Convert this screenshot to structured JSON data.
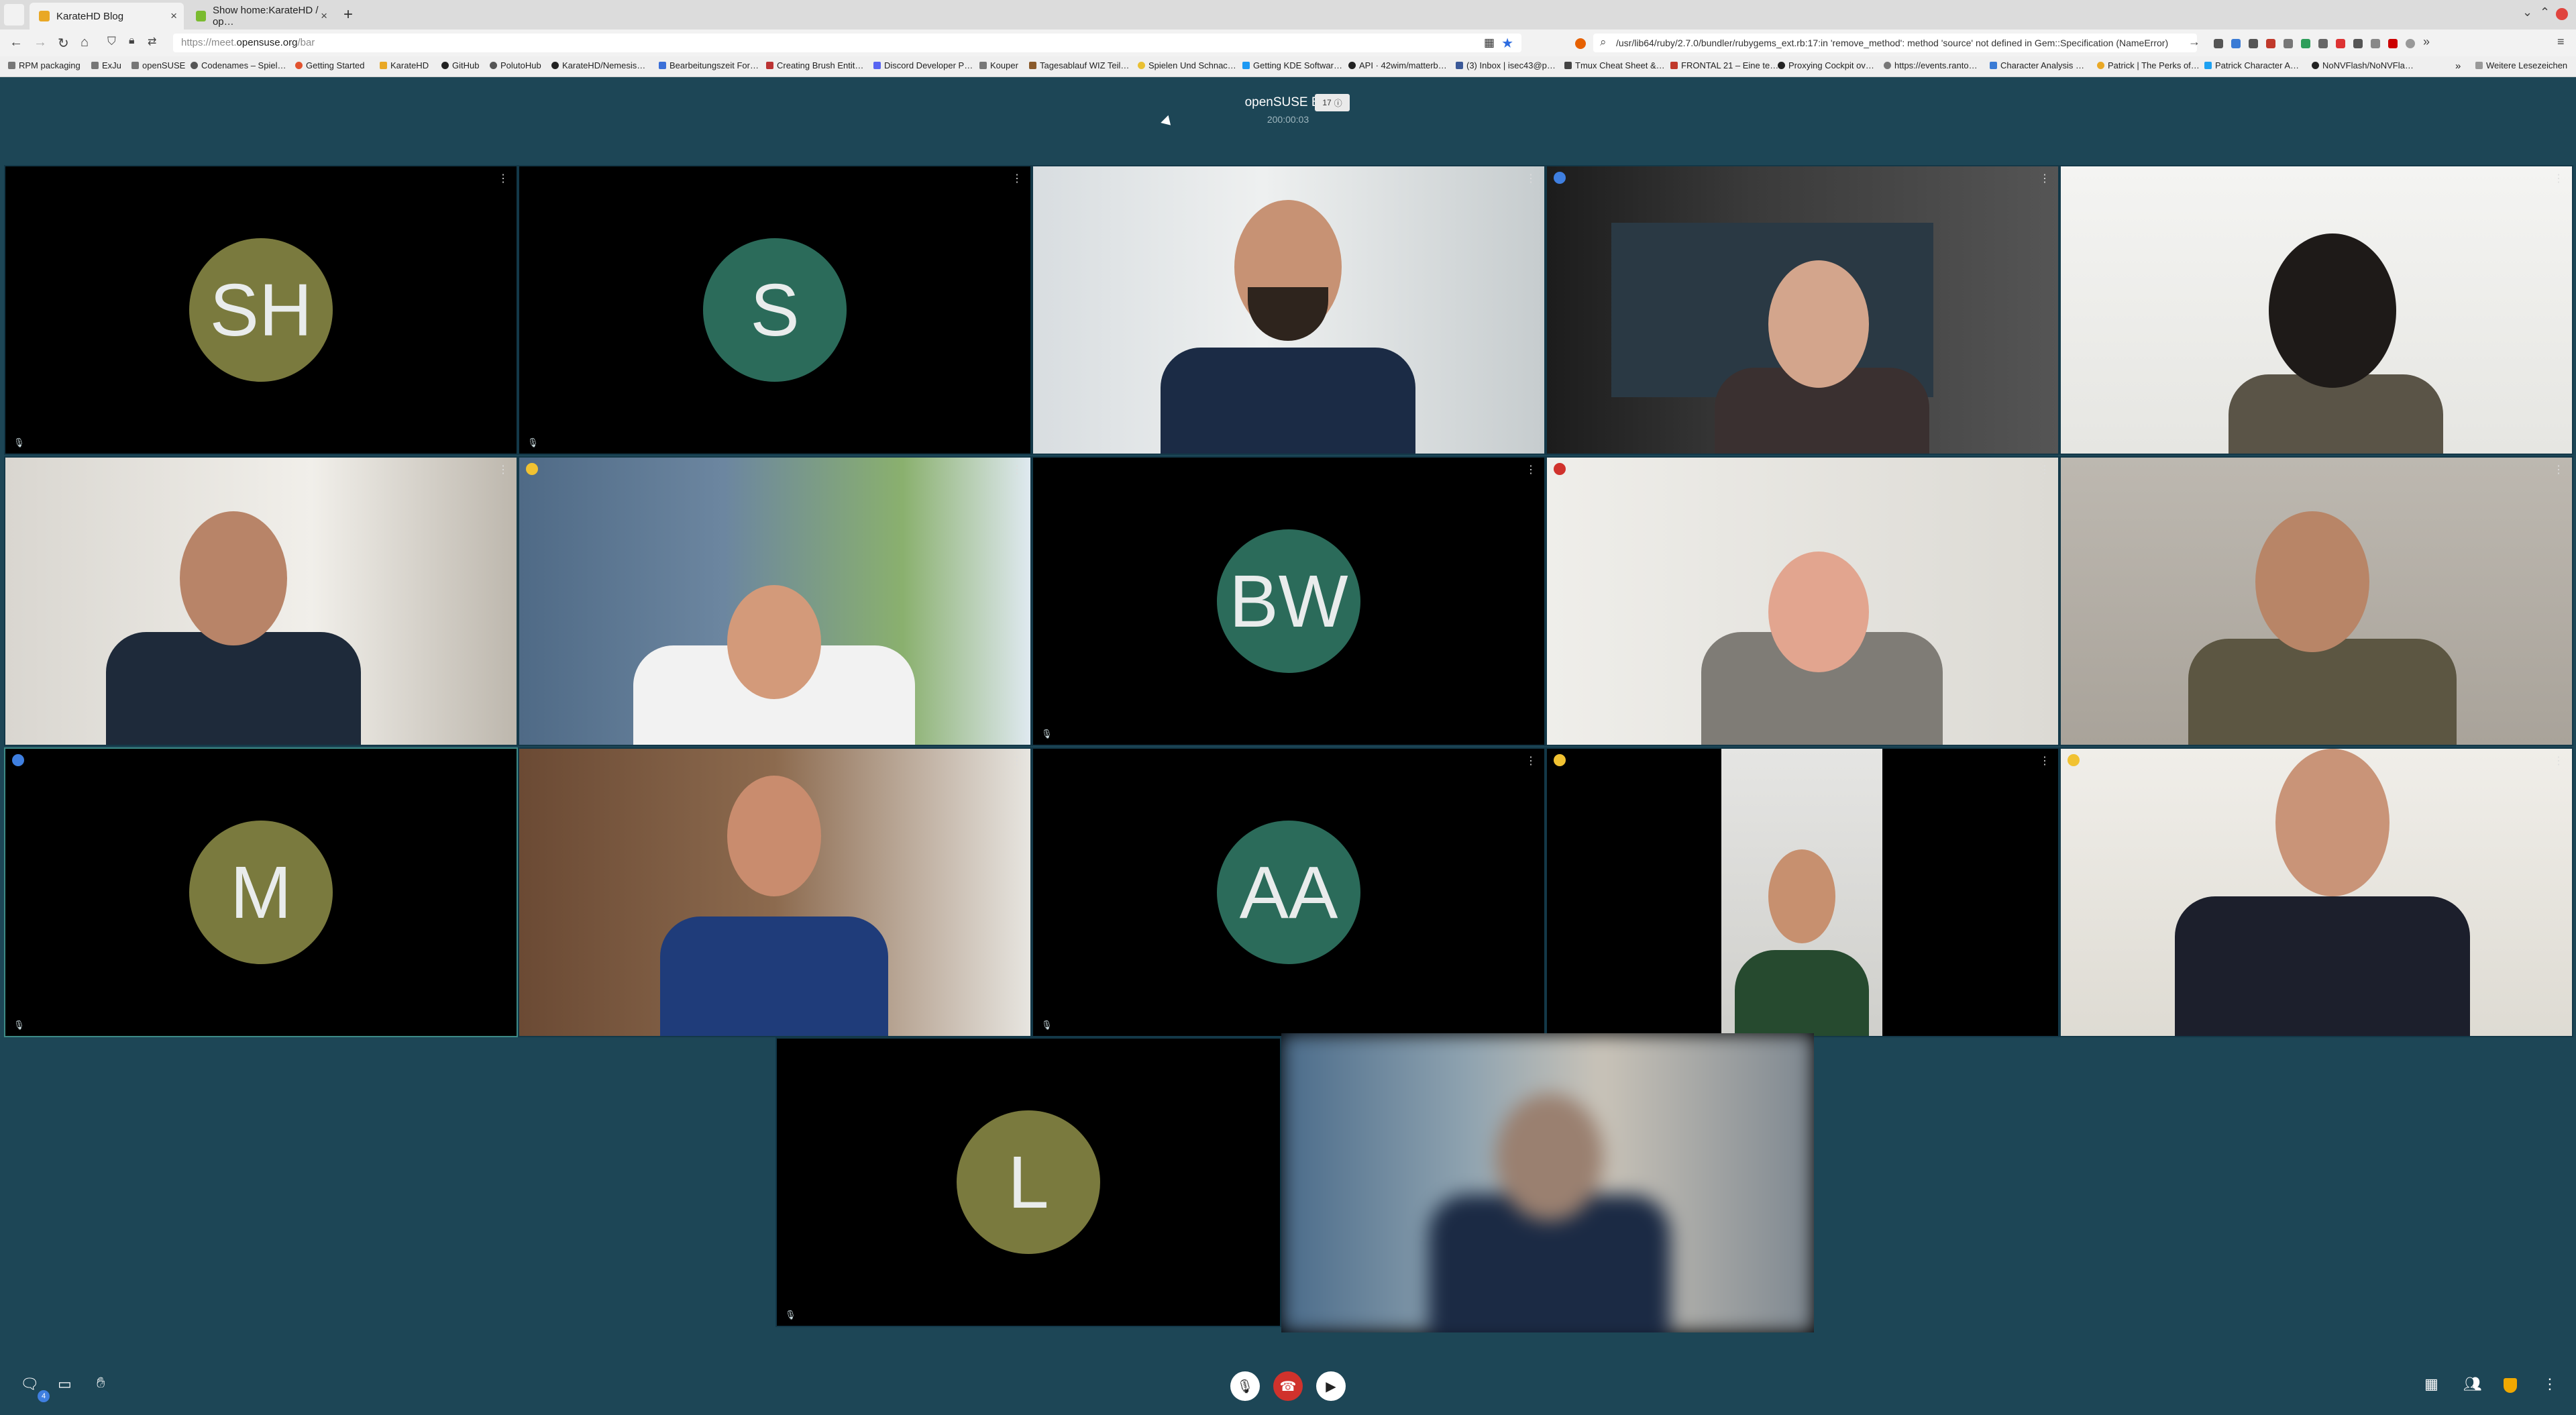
{
  "browser": {
    "tabs": [
      {
        "label": "KarateHD Blog",
        "color": "#e9a825"
      },
      {
        "label": "Show home:KarateHD / op…",
        "color": "#7abb2f"
      }
    ],
    "url_prefix": "https://meet.",
    "url_domain": "opensuse.org",
    "url_path": "/bar",
    "search_text": "/usr/lib64/ruby/2.7.0/bundler/rubygems_ext.rb:17:in 'remove_method': method 'source' not defined in Gem::Specification (NameError)",
    "bookmarks": [
      "RPM packaging",
      "ExJu",
      "openSUSE",
      "Codenames – Spiel…",
      "Getting Started",
      "KarateHD",
      "GitHub",
      "PolutoHub",
      "KarateHD/Nemesis…",
      "Bearbeitungszeit For…",
      "Creating Brush Entit…",
      "Discord Developer P…",
      "Kouper",
      "Tagesablauf WIZ Teil…",
      "Spielen Und Schnac…",
      "Getting KDE Softwar…",
      "API · 42wim/matterb…",
      "(3) Inbox | isec43@p…",
      "Tmux Cheat Sheet &…",
      "FRONTAL 21 – Eine te…",
      "Proxying Cockpit ov…",
      "https://events.ranto…",
      "Character Analysis …",
      "Patrick | The Perks of…",
      "Patrick Character A…",
      "NoNVFlash/NoNVFla…"
    ],
    "bookmarks_more": "Weitere Lesezeichen"
  },
  "meeting": {
    "title": "openSUSE Bar",
    "timer": "200:00:03",
    "participant_badge": "17",
    "chat_badge": "4"
  },
  "participants": [
    {
      "initials": "SH",
      "avatar_color": "#7a7a3e"
    },
    {
      "initials": "S",
      "avatar_color": "#2b6b5a"
    },
    {
      "initials": "BW",
      "avatar_color": "#2b6b5a"
    },
    {
      "initials": "M",
      "avatar_color": "#7a7a3e"
    },
    {
      "initials": "AA",
      "avatar_color": "#2b6b5a"
    },
    {
      "initials": "L",
      "avatar_color": "#7a7a3e"
    }
  ],
  "colors": {
    "background": "#1d4656",
    "hangup": "#d0322c",
    "dot_yellow": "#f1c232",
    "dot_red": "#d0322c",
    "dot_blue": "#3f7fe0"
  }
}
